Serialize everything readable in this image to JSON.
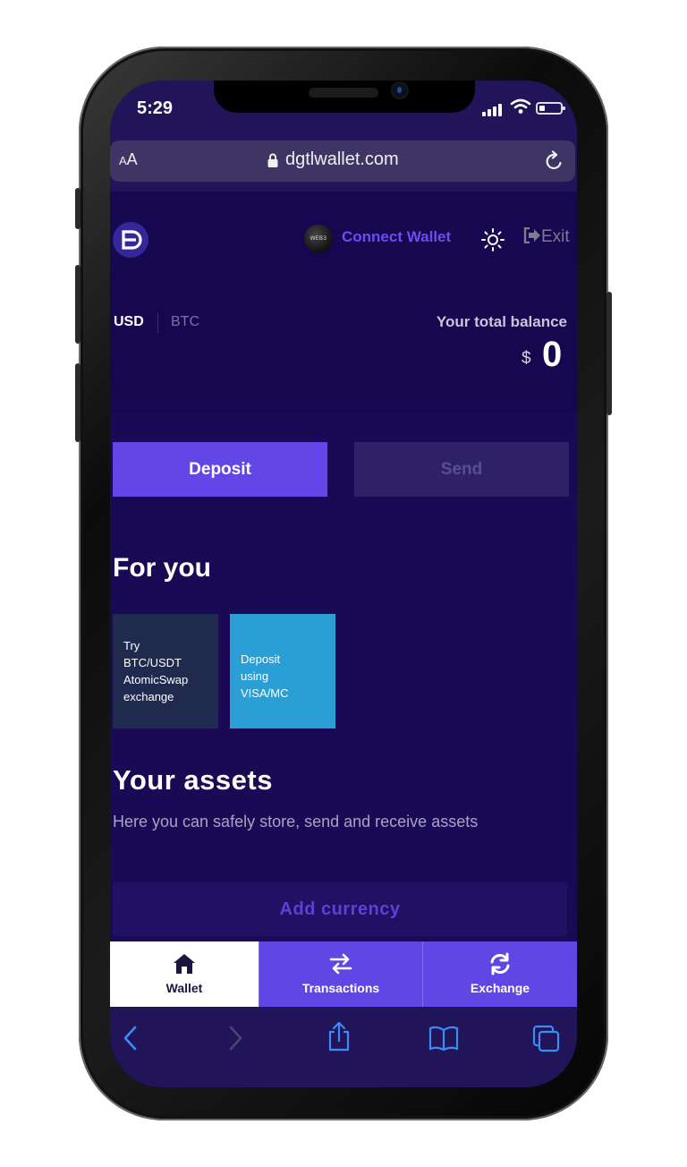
{
  "status_bar": {
    "time": "5:29"
  },
  "browser": {
    "text_size_label_small": "A",
    "text_size_label_large": "A",
    "url": "dgtlwallet.com"
  },
  "header": {
    "web3_badge": "WEB3",
    "connect_wallet": "Connect Wallet",
    "exit": "Exit"
  },
  "balance": {
    "currency_tabs": [
      "USD",
      "BTC"
    ],
    "selected_currency": "USD",
    "label": "Your total balance",
    "currency_symbol": "$",
    "value": "0"
  },
  "actions": {
    "deposit": "Deposit",
    "send": "Send"
  },
  "for_you": {
    "title": "For you",
    "cards": [
      {
        "lines": [
          "Try",
          "BTC/USDT",
          "AtomicSwap",
          "exchange"
        ],
        "color": "#1f2a4e"
      },
      {
        "lines": [
          "Deposit",
          "using",
          "VISA/MC"
        ],
        "color": "#2a9fd6"
      }
    ]
  },
  "assets": {
    "title": "Your assets",
    "subtitle": "Here you can safely store, send and receive assets",
    "add_button": "Add currency"
  },
  "tab_bar": {
    "items": [
      {
        "label": "Wallet",
        "icon": "home-icon",
        "active": true
      },
      {
        "label": "Transactions",
        "icon": "swap-arrows-icon",
        "active": false
      },
      {
        "label": "Exchange",
        "icon": "refresh-icon",
        "active": false
      }
    ]
  },
  "safari_toolbar": {
    "icons": [
      "back-icon",
      "forward-icon",
      "share-icon",
      "bookmarks-icon",
      "tabs-icon"
    ]
  },
  "colors": {
    "accent": "#6246e8",
    "background": "#1a0954",
    "link": "#6a4ef2",
    "card_blue": "#2a9fd6"
  }
}
